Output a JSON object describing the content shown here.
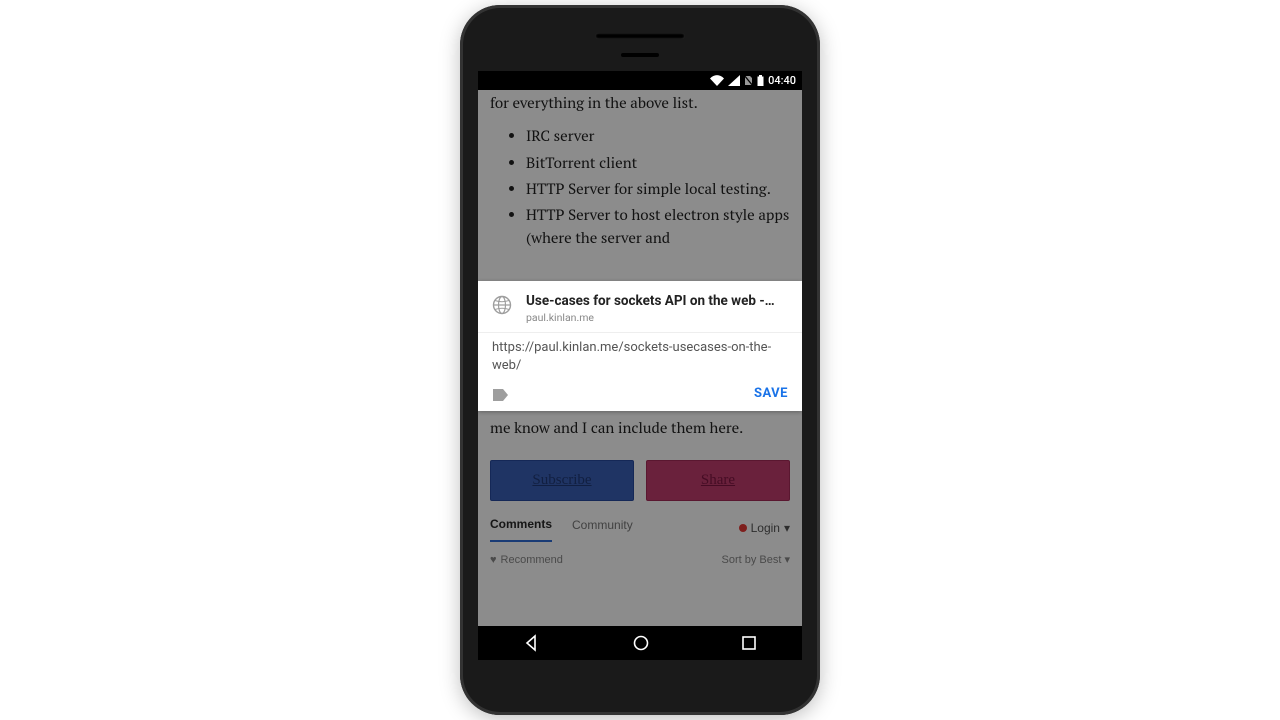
{
  "statusbar": {
    "time": "04:40"
  },
  "article": {
    "topline": "for everything in the above list.",
    "list": [
      "IRC server",
      "BitTorrent client",
      "HTTP Server for simple local testing.",
      "HTTP Server to host electron style apps (where the server and"
    ],
    "paragraph_tail": "me know and I can include them here.",
    "subscribe_label": "Subscribe",
    "share_label": "Share"
  },
  "disqus": {
    "tab_comments": "Comments",
    "tab_community": "Community",
    "login": "Login",
    "recommend": "Recommend",
    "sort": "Sort by Best"
  },
  "share_sheet": {
    "title": "Use-cases for sockets API on the web -…",
    "domain": "paul.kinlan.me",
    "url": "https://paul.kinlan.me/sockets-usecases-on-the-web/",
    "save_label": "SAVE"
  }
}
